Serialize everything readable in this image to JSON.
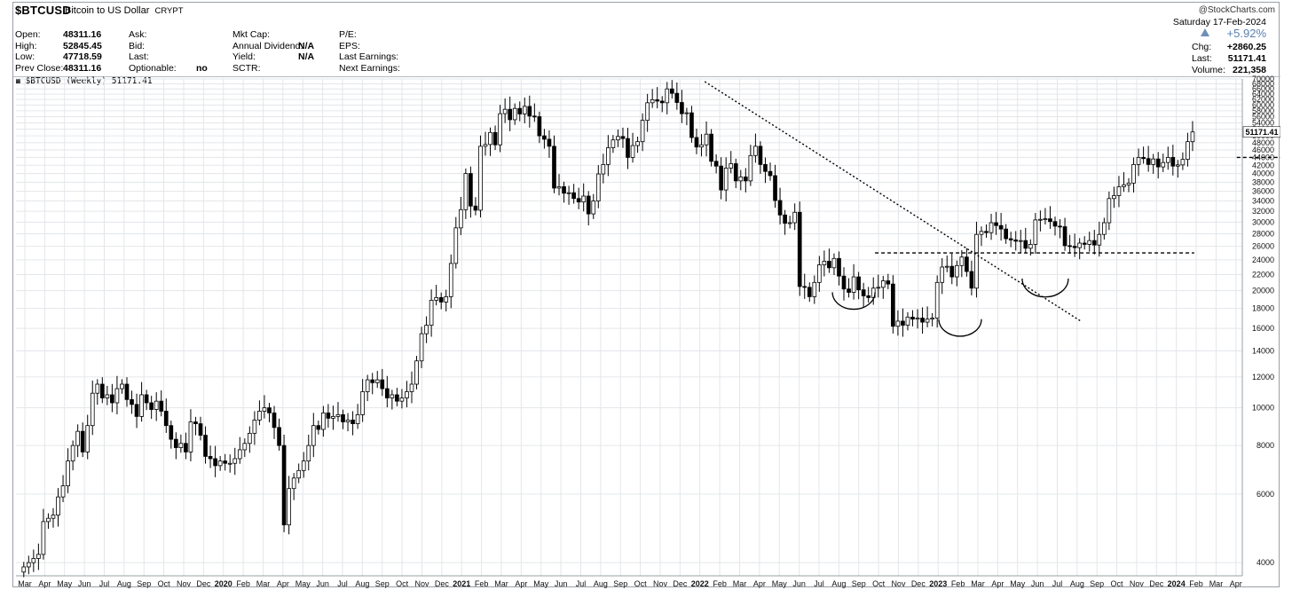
{
  "header": {
    "symbol": "$BTCUSD",
    "name": "Bitcoin to US Dollar",
    "exchange": "CRYPT",
    "credit": "@StockCharts.com"
  },
  "info_col1": [
    {
      "label": "Open:",
      "value": "48311.16"
    },
    {
      "label": "High:",
      "value": "52845.45"
    },
    {
      "label": "Low:",
      "value": "47718.59"
    },
    {
      "label": "Prev Close:",
      "value": "48311.16"
    }
  ],
  "info_col2": [
    {
      "label": "Ask:",
      "value": ""
    },
    {
      "label": "Bid:",
      "value": ""
    },
    {
      "label": "Last:",
      "value": ""
    },
    {
      "label": "Optionable:",
      "value": "no"
    }
  ],
  "info_col3": [
    {
      "label": "Mkt Cap:",
      "value": ""
    },
    {
      "label": "Annual Dividend:",
      "value": "N/A"
    },
    {
      "label": "Yield:",
      "value": "N/A"
    },
    {
      "label": "SCTR:",
      "value": ""
    }
  ],
  "info_col4": [
    {
      "label": "P/E:",
      "value": ""
    },
    {
      "label": "EPS:",
      "value": ""
    },
    {
      "label": "Last Earnings:",
      "value": ""
    },
    {
      "label": "Next Earnings:",
      "value": ""
    }
  ],
  "quote": {
    "date": "Saturday  17-Feb-2024",
    "change_pct": "+5.92%",
    "chg_label": "Chg:",
    "chg_value": "+2860.25",
    "last_label": "Last:",
    "last_value": "51171.41",
    "volume_label": "Volume:",
    "volume_value": "221,358"
  },
  "legend": "$BTCUSD (Weekly) 51171.41",
  "colors": {
    "up": "#ffffff",
    "down": "#000000",
    "grid": "#e3e6ea",
    "trendline": "#000000",
    "last_tag_bg": "#ffffff"
  },
  "chart_data": {
    "type": "candlestick",
    "period": "Weekly",
    "y_scale": "log",
    "ylim": [
      3700,
      70000
    ],
    "y_ticks": [
      4000,
      6000,
      8000,
      10000,
      12000,
      14000,
      16000,
      18000,
      20000,
      22000,
      24000,
      26000,
      28000,
      30000,
      32000,
      34000,
      36000,
      38000,
      40000,
      42000,
      44000,
      46000,
      48000,
      50000,
      52000,
      54000,
      56000,
      58000,
      60000,
      62000,
      64000,
      66000,
      68000,
      70000
    ],
    "last_price_label": "51171.41",
    "x_labels": [
      "Mar",
      "Apr",
      "May",
      "Jun",
      "Jul",
      "Aug",
      "Sep",
      "Oct",
      "Nov",
      "Dec",
      "2020",
      "Feb",
      "Mar",
      "Apr",
      "May",
      "Jun",
      "Jul",
      "Aug",
      "Sep",
      "Oct",
      "Nov",
      "Dec",
      "2021",
      "Feb",
      "Mar",
      "Apr",
      "May",
      "Jun",
      "Jul",
      "Aug",
      "Sep",
      "Oct",
      "Nov",
      "Dec",
      "2022",
      "Feb",
      "Mar",
      "Apr",
      "May",
      "Jun",
      "Jul",
      "Aug",
      "Sep",
      "Oct",
      "Nov",
      "Dec",
      "2023",
      "Feb",
      "Mar",
      "Apr",
      "May",
      "Jun",
      "Jul",
      "Aug",
      "Sep",
      "Oct",
      "Nov",
      "Dec",
      "2024",
      "Feb",
      "Mar",
      "Apr"
    ],
    "x_start": "2019-03",
    "weekly_closes": [
      3900,
      4000,
      4100,
      4200,
      5100,
      5200,
      5300,
      5900,
      6300,
      7300,
      8000,
      8700,
      7700,
      9000,
      10900,
      11500,
      10600,
      10800,
      10300,
      11200,
      11500,
      10500,
      10200,
      9500,
      10800,
      10300,
      9900,
      10400,
      9800,
      9000,
      8300,
      7900,
      8100,
      7700,
      9200,
      9100,
      8500,
      7500,
      7400,
      7100,
      7300,
      7200,
      7200,
      7400,
      7800,
      8100,
      8600,
      9300,
      9800,
      10000,
      9700,
      8900,
      8000,
      5000,
      6200,
      6600,
      6900,
      7300,
      8000,
      9000,
      8800,
      9700,
      9400,
      9500,
      9600,
      9200,
      9300,
      9100,
      9600,
      11000,
      11800,
      11600,
      11800,
      11200,
      10600,
      10800,
      10400,
      10600,
      11000,
      11500,
      13200,
      15500,
      16300,
      18900,
      19200,
      18700,
      19300,
      23500,
      29000,
      32300,
      40000,
      33000,
      32200,
      47000,
      47500,
      51000,
      47400,
      57000,
      58500,
      55000,
      58800,
      56900,
      59500,
      56200,
      56000,
      50000,
      49000,
      47000,
      36700,
      37000,
      35600,
      35700,
      34500,
      33800,
      35000,
      31500,
      34000,
      39900,
      42200,
      46600,
      48800,
      49800,
      49200,
      44000,
      47200,
      48300,
      54800,
      60800,
      61900,
      61400,
      60800,
      66000,
      64300,
      60900,
      57000,
      57300,
      49500,
      46800,
      47400,
      50500,
      43000,
      41800,
      36300,
      41300,
      42400,
      38300,
      39200,
      38300,
      44500,
      47000,
      42200,
      40500,
      39500,
      34100,
      31300,
      29800,
      29900,
      31800,
      20500,
      20400,
      19300,
      21000,
      23300,
      23800,
      22900,
      24200,
      21800,
      20200,
      19800,
      21700,
      20100,
      19400,
      19200,
      20300,
      20400,
      21200,
      20800,
      16200,
      16700,
      16300,
      17100,
      16900,
      17000,
      16600,
      16900,
      17000,
      21000,
      23000,
      23100,
      21700,
      23200,
      24400,
      22400,
      20300,
      27900,
      28400,
      28200,
      29900,
      29400,
      28800,
      27200,
      27000,
      26800,
      26900,
      25700,
      26300,
      30400,
      30500,
      30600,
      30100,
      29300,
      29200,
      26100,
      26000,
      25800,
      26500,
      26300,
      26900,
      26200,
      27900,
      29900,
      34500,
      35100,
      37000,
      37400,
      37800,
      42200,
      44000,
      43700,
      42200,
      43600,
      41600,
      42700,
      44000,
      41800,
      42100,
      43500,
      48300,
      51171
    ],
    "annotations": {
      "trendline": {
        "from": [
          "2021-11",
          68900
        ],
        "to": [
          "2023-03",
          16700
        ],
        "style": "dotted"
      },
      "neckline_2022": {
        "level": 25000,
        "from": "2022-07",
        "to": "2023-10",
        "style": "dashed"
      },
      "neckline_2024": {
        "level": 44000,
        "from": "2023-12",
        "to": "2024-03",
        "style": "dashed"
      },
      "arcs": [
        "left shoulder 2022-06",
        "head 2022-11",
        "right shoulder 2023-03"
      ]
    }
  }
}
